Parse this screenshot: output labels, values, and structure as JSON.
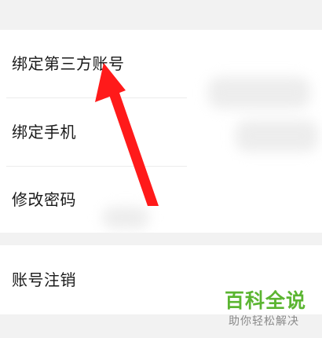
{
  "settings": {
    "items": [
      {
        "label": "绑定第三方账号"
      },
      {
        "label": "绑定手机"
      },
      {
        "label": "修改密码"
      }
    ],
    "deactivate": {
      "label": "账号注销"
    }
  },
  "watermark": {
    "title": "百科全说",
    "subtitle": "助你轻松解决",
    "color": "#5bb531"
  },
  "annotation": {
    "icon": "red-arrow-icon",
    "color": "#ff1a1a"
  }
}
